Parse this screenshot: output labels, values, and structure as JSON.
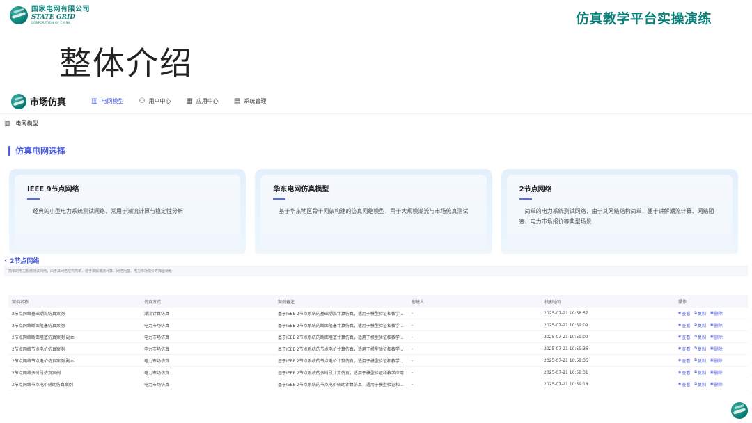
{
  "slide": {
    "logo_cn": "国家电网有限公司",
    "logo_en": "STATE GRID",
    "logo_sub": "CORPORATION OF CHINA",
    "title_right": "仿真教学平台实操演练",
    "heading": "整体介绍"
  },
  "app": {
    "brand": "市场仿真",
    "nav": [
      {
        "label": "电网模型",
        "icon": "grid-icon",
        "active": true
      },
      {
        "label": "用户中心",
        "icon": "users-icon",
        "active": false
      },
      {
        "label": "应用中心",
        "icon": "apps-icon",
        "active": false
      },
      {
        "label": "系统管理",
        "icon": "settings-icon",
        "active": false
      }
    ],
    "breadcrumb": "电网模型",
    "section_title": "仿真电网选择"
  },
  "cards": [
    {
      "title": "IEEE 9节点网络",
      "desc": "经典的小型电力系统测试网络，常用于潮流计算与稳定性分析"
    },
    {
      "title": "华东电网仿真模型",
      "desc": "基于华东地区骨干网架构建的仿真网络模型，用于大规模潮流与市场仿真测试"
    },
    {
      "title": "2节点网络",
      "desc": "简单的电力系统测试网络，由于其网络结构简单，便于讲解潮流计算、网络阻塞、电力市场报价等典型场景"
    }
  ],
  "detail": {
    "title": "2节点网络",
    "desc": "简单的电力系统测试网络，由于其网络结构简单，便于讲解潮流计算、网络阻塞、电力市场报价等典型场景"
  },
  "table": {
    "headers": [
      "案例名称",
      "仿真方式",
      "案例备注",
      "创建人",
      "创建时间",
      "操作"
    ],
    "rows": [
      {
        "name": "2节点网络基础潮流仿真案例",
        "mode": "潮流计算仿真",
        "note": "基于IEEE 2节点系统的基础潮流计算仿真，适用于模型验证和教学...",
        "creator": "-",
        "time": "2025-07-21 10:58:57"
      },
      {
        "name": "2节点网络断面阻塞仿真案例",
        "mode": "电力市场仿真",
        "note": "基于IEEE 2节点系统的断面阻塞计算仿真，适用于模型验证和教学...",
        "creator": "-",
        "time": "2025-07-21 10:59:09"
      },
      {
        "name": "2节点网络断面阻塞仿真案例 副本",
        "mode": "电力市场仿真",
        "note": "基于IEEE 2节点系统的断面阻塞计算仿真，适用于模型验证和教学...",
        "creator": "-",
        "time": "2025-07-21 10:59:09"
      },
      {
        "name": "2节点网络节点电价仿真案例",
        "mode": "电力市场仿真",
        "note": "基于IEEE 2节点系统的节点电价计算仿真，适用于模型验证和教学...",
        "creator": "-",
        "time": "2025-07-21 10:59:36"
      },
      {
        "name": "2节点网络节点电价仿真案例 副本",
        "mode": "电力市场仿真",
        "note": "基于IEEE 2节点系统的节点电价计算仿真，适用于模型验证和教学...",
        "creator": "-",
        "time": "2025-07-21 10:59:36"
      },
      {
        "name": "2节点网络多时段仿真案例",
        "mode": "电力市场仿真",
        "note": "基于IEEE 2节点系统的多时段计算仿真，适用于模型验证和教学应用",
        "creator": "-",
        "time": "2025-07-21 10:59:31"
      },
      {
        "name": "2节点网络节点电价辅助仿真案例",
        "mode": "电力市场仿真",
        "note": "基于IEEE 2节点系统的节点电价辅助计算仿真，适用于模型验证和...",
        "creator": "-",
        "time": "2025-07-21 10:59:18"
      }
    ],
    "actions": {
      "view": "查看",
      "copy": "复制",
      "delete": "删除"
    }
  },
  "colors": {
    "brand": "#0b7f78",
    "accent": "#4a5bdc"
  }
}
